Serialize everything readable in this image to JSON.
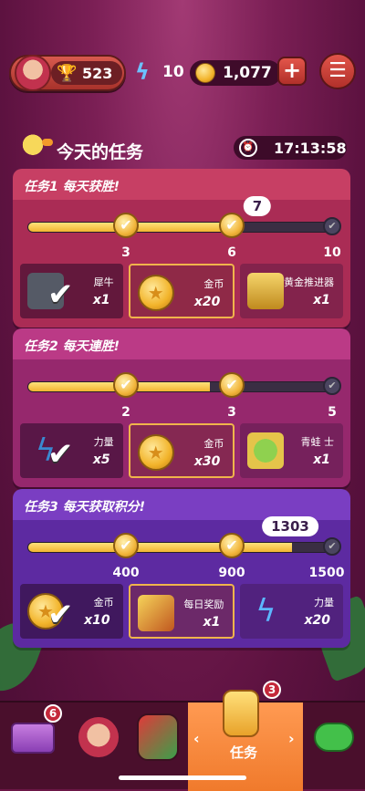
{
  "topbar": {
    "trophies": "523",
    "energy": "10",
    "coins": "1,077",
    "plus": "+",
    "menu": "☰"
  },
  "header": {
    "title": "今天的任务",
    "timer": "17:13:58"
  },
  "missions": [
    {
      "title": "任务1 每天获胜!",
      "progress_bubble": "7",
      "progress_fraction": 0.7,
      "milestones": [
        "3",
        "6",
        "10"
      ],
      "rewards": [
        {
          "name": "犀牛",
          "qty": "x1"
        },
        {
          "name": "金币",
          "qty": "x20"
        },
        {
          "name": "黄金推进器",
          "qty": "x1"
        }
      ]
    },
    {
      "title": "任务2 每天連胜!",
      "progress_fraction": 0.6,
      "milestones": [
        "2",
        "3",
        "5"
      ],
      "rewards": [
        {
          "name": "力量",
          "qty": "x5"
        },
        {
          "name": "金币",
          "qty": "x30"
        },
        {
          "name": "青蛙 士",
          "qty": "x1"
        }
      ]
    },
    {
      "title": "任务3 每天获取积分!",
      "progress_bubble": "1303",
      "progress_fraction": 0.87,
      "milestones": [
        "400",
        "900",
        "1500"
      ],
      "rewards": [
        {
          "name": "金币",
          "qty": "x10"
        },
        {
          "name": "每日奖励",
          "qty": "x1"
        },
        {
          "name": "力量",
          "qty": "x20"
        }
      ]
    }
  ],
  "bottom_nav": {
    "shop_badge": "6",
    "missions_badge": "3",
    "missions_label": "任务",
    "left_arrow": "‹",
    "right_arrow": "›"
  },
  "icons": [
    "avatar-icon",
    "trophy-icon",
    "bolt-icon",
    "coin-icon",
    "plus-icon",
    "menu-icon",
    "bird-icon",
    "clock-icon",
    "check-icon",
    "chest-icon",
    "emblem-icon",
    "chat-icon"
  ],
  "colors": {
    "gold": "#f2b430",
    "card1": "#c73f64",
    "card2": "#bb3a86",
    "card3": "#7a3ec2",
    "active_tab": "#f07a2c"
  }
}
